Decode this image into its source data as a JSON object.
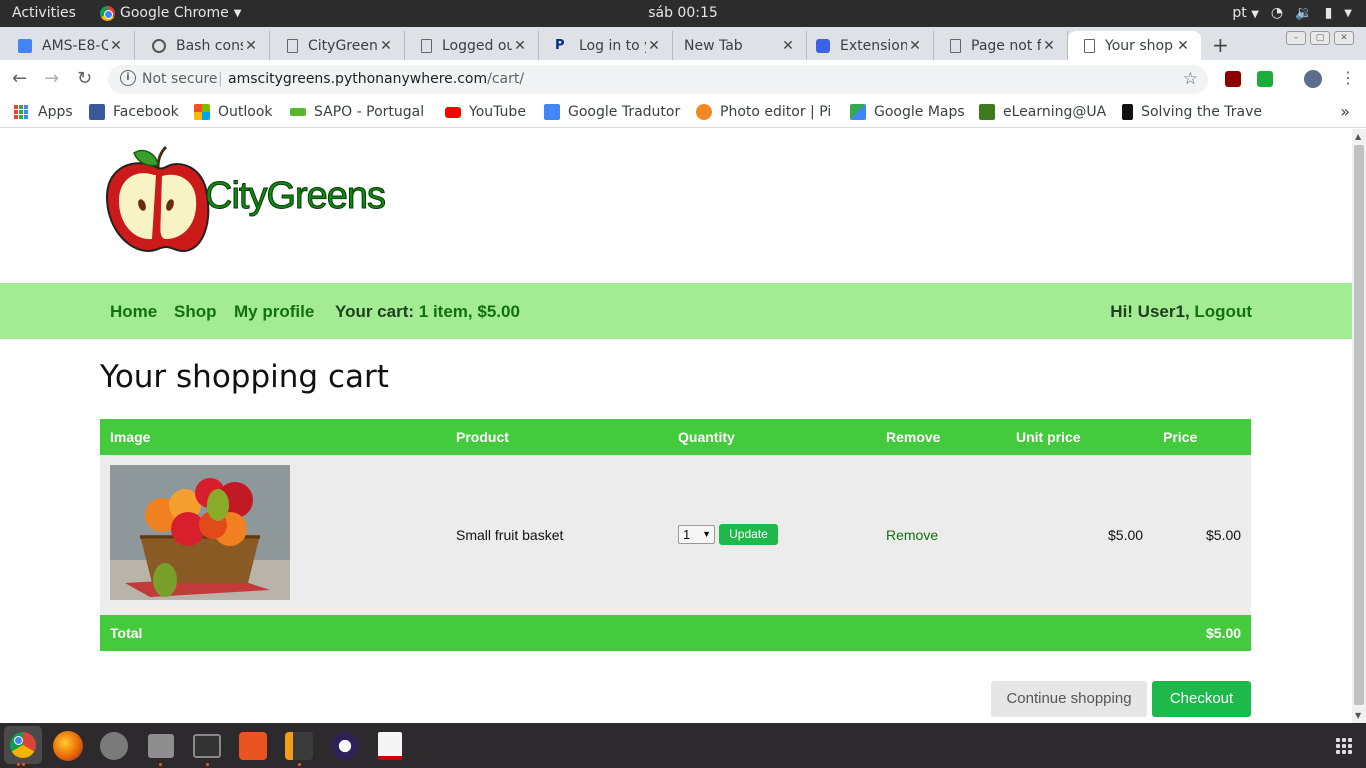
{
  "system": {
    "activities": "Activities",
    "app_name": "Google Chrome",
    "clock": "sáb 00:15",
    "lang": "pt"
  },
  "tabs": [
    {
      "label": "AMS-E8-Q",
      "icon": "docs-icon"
    },
    {
      "label": "Bash cons",
      "icon": "pythonanywhere-icon"
    },
    {
      "label": "CityGreen",
      "icon": "page-icon"
    },
    {
      "label": "Logged ou",
      "icon": "page-icon"
    },
    {
      "label": "Log in to y",
      "icon": "paypal-icon"
    },
    {
      "label": "New Tab",
      "icon": ""
    },
    {
      "label": "Extension",
      "icon": "puzzle-icon"
    },
    {
      "label": "Page not f",
      "icon": "page-icon"
    },
    {
      "label": "Your shop",
      "icon": "page-icon",
      "active": true
    }
  ],
  "address_bar": {
    "security": "Not secure",
    "host": "amscitygreens.pythonanywhere.com",
    "path": "/cart/"
  },
  "bookmarks": [
    {
      "label": "Apps",
      "icon": "apps-grid-icon"
    },
    {
      "label": "Facebook",
      "icon": "facebook-icon",
      "color": "#3b5998"
    },
    {
      "label": "Outlook",
      "icon": "microsoft-icon",
      "color": "#f25022"
    },
    {
      "label": "SAPO - Portugal",
      "icon": "sapo-icon",
      "color": "#5ab82e"
    },
    {
      "label": "YouTube",
      "icon": "youtube-icon",
      "color": "#ff0000"
    },
    {
      "label": "Google Tradutor",
      "icon": "translate-icon",
      "color": "#4285f4"
    },
    {
      "label": "Photo editor | Pi",
      "icon": "photo-editor-icon",
      "color": "#f08a24"
    },
    {
      "label": "Google Maps",
      "icon": "maps-icon",
      "color": "#34a853"
    },
    {
      "label": "eLearning@UA",
      "icon": "elearning-icon",
      "color": "#3f7a1f"
    },
    {
      "label": "Solving the Trave",
      "icon": "medium-icon",
      "color": "#111111"
    }
  ],
  "site": {
    "brand": "CityGreens",
    "nav": {
      "home": "Home",
      "shop": "Shop",
      "profile": "My profile",
      "cart_label": "Your cart:",
      "cart_value": "1 item, $5.00",
      "greeting": "Hi! User1,",
      "logout": "Logout"
    },
    "title": "Your shopping cart",
    "table": {
      "headers": {
        "image": "Image",
        "product": "Product",
        "quantity": "Quantity",
        "remove": "Remove",
        "unit_price": "Unit price",
        "price": "Price"
      },
      "rows": [
        {
          "product": "Small fruit basket",
          "quantity": "1",
          "update": "Update",
          "remove": "Remove",
          "unit_price": "$5.00",
          "price": "$5.00"
        }
      ],
      "total_label": "Total",
      "total_value": "$5.00"
    },
    "continue_btn": "Continue shopping",
    "checkout_btn": "Checkout"
  },
  "colors": {
    "nav_bg": "#a3ec93",
    "table_header": "#44cb3d",
    "button_green": "#1db94a",
    "link_green": "#127012"
  },
  "dock": [
    "chrome-icon",
    "firefox-icon",
    "settings-icon",
    "files-icon",
    "terminal-icon",
    "software-center-icon",
    "sublime-icon",
    "eclipse-icon",
    "document-viewer-icon"
  ]
}
